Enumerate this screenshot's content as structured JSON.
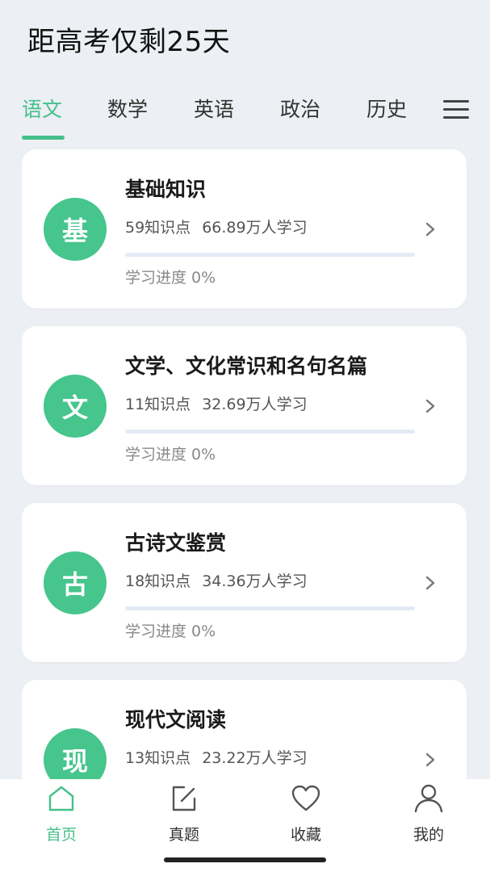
{
  "header": {
    "countdown": "距高考仅剩25天"
  },
  "tabs": [
    {
      "label": "语文",
      "active": true
    },
    {
      "label": "数学"
    },
    {
      "label": "英语"
    },
    {
      "label": "政治"
    },
    {
      "label": "历史"
    }
  ],
  "menu_icon": "hamburger-menu-icon",
  "accent_color": "#45c08b",
  "cards": [
    {
      "badge": "基",
      "title": "基础知识",
      "points": "59知识点",
      "learners": "66.89万人学习",
      "progress_label": "学习进度 0%",
      "progress": 0
    },
    {
      "badge": "文",
      "title": "文学、文化常识和名句名篇",
      "points": "11知识点",
      "learners": "32.69万人学习",
      "progress_label": "学习进度 0%",
      "progress": 0
    },
    {
      "badge": "古",
      "title": "古诗文鉴赏",
      "points": "18知识点",
      "learners": "34.36万人学习",
      "progress_label": "学习进度 0%",
      "progress": 0
    },
    {
      "badge": "现",
      "title": "现代文阅读",
      "points": "13知识点",
      "learners": "23.22万人学习"
    }
  ],
  "bottom_nav": [
    {
      "label": "首页",
      "icon": "home-icon",
      "active": true
    },
    {
      "label": "真题",
      "icon": "edit-icon"
    },
    {
      "label": "收藏",
      "icon": "heart-icon"
    },
    {
      "label": "我的",
      "icon": "user-icon"
    }
  ]
}
